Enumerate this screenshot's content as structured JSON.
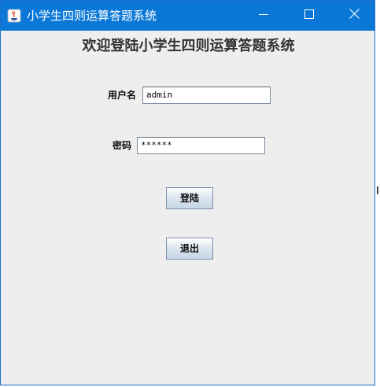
{
  "window": {
    "title": "小学生四则运算答题系统"
  },
  "titlebar_buttons": {
    "minimize_icon": "minimize-icon",
    "maximize_icon": "maximize-icon",
    "close_icon": "close-icon"
  },
  "main": {
    "heading": "欢迎登陆小学生四则运算答题系统",
    "username": {
      "label": "用户名",
      "value": "admin"
    },
    "password": {
      "label": "密码",
      "value": "******"
    },
    "login_label": "登陆",
    "exit_label": "退出"
  },
  "colors": {
    "titlebar": "#0b78d7",
    "window_bg": "#eeeeee"
  }
}
